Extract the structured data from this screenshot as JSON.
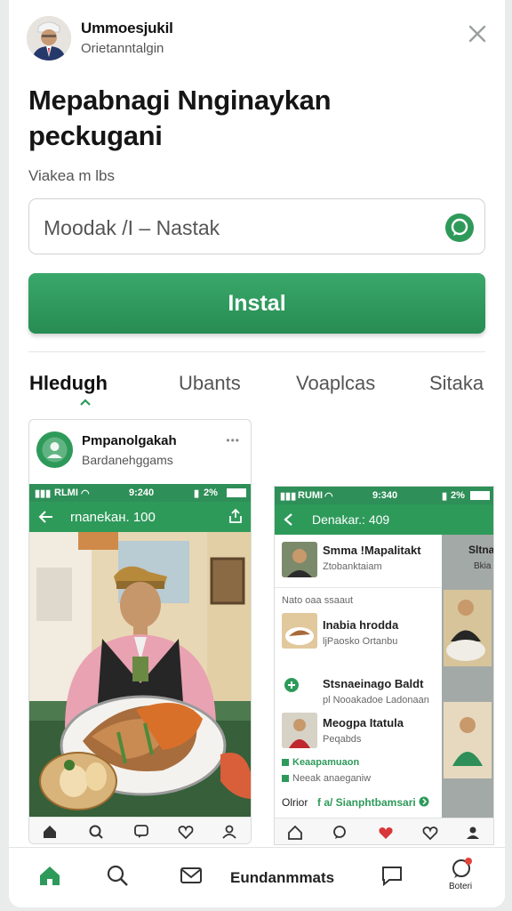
{
  "header": {
    "app_name": "Ummoesjukil",
    "app_subtitle": "Orietanntalgin"
  },
  "main": {
    "title_line1": "Mepabnagi Nnginaykan",
    "title_line2": "peckugani",
    "subtitle": "Viakea m lbs"
  },
  "search": {
    "value": "Moodak /I – Nastak"
  },
  "install_label": "Instal",
  "tabs": [
    {
      "label": "Hledugh",
      "active": true
    },
    {
      "label": "Ubants"
    },
    {
      "label": "Voaplcas"
    },
    {
      "label": "Sitaka"
    }
  ],
  "card": {
    "title": "Pmpanolgakah",
    "subtitle": "Bardanehggams",
    "more": "•••",
    "status": {
      "signal": "RLMI",
      "time": "9:240",
      "battery": "2%"
    },
    "appbar_title": "rnanekaн. 100"
  },
  "screenshot2": {
    "status": {
      "signal": "RUMI",
      "time": "9:340",
      "battery": "2%"
    },
    "appbar_title": "Denakar.: 409",
    "top_item": {
      "title": "Smma !Mapalitakt",
      "subtitle": "Ztobanktaiam"
    },
    "section_label": "Nato oaa ssaaut",
    "items": [
      {
        "title": "Inabia hrodda",
        "subtitle": "ljPaosko Ortanbu"
      },
      {
        "title": "Stsnaeinago Baldt",
        "subtitle": "pl Nooakadoe Ladonaan"
      },
      {
        "title": "Meogpa Itatula",
        "subtitle": "Peqabds"
      }
    ],
    "green_line1": "Keaapamuaon",
    "green_line2": "Neeak anaeganiw",
    "footer_label": "Olrior",
    "footer_green": "f a/ Sianphtbamsari",
    "side_label": "Sltna",
    "side_sub": "Bkia"
  },
  "bottom_nav": {
    "label": "Eundanmmats",
    "label_small": "Boteri"
  },
  "colors": {
    "accent": "#2e9a5a",
    "accent_dark": "#278c52"
  }
}
